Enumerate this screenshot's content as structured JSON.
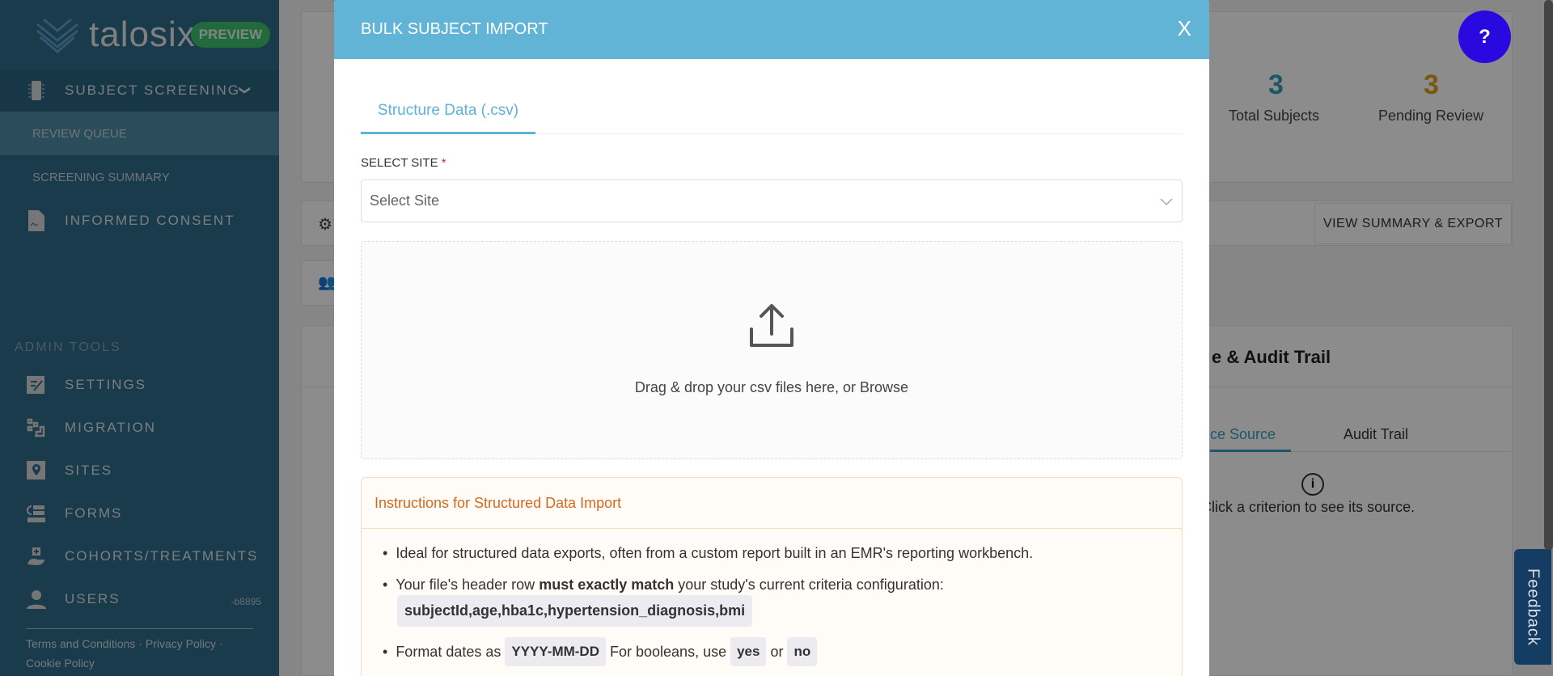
{
  "brand": {
    "name": "talosix",
    "badge": "PREVIEW"
  },
  "sidebar": {
    "section_main": {
      "label": "SUBJECT SCREENING",
      "sub_items": [
        {
          "label": "REVIEW QUEUE"
        },
        {
          "label": "SCREENING SUMMARY"
        }
      ]
    },
    "informed_consent": "INFORMED CONSENT",
    "admin_title": "ADMIN TOOLS",
    "admin_items": [
      {
        "label": "SETTINGS"
      },
      {
        "label": "MIGRATION"
      },
      {
        "label": "SITES"
      },
      {
        "label": "FORMS"
      },
      {
        "label": "COHORTS/TREATMENTS"
      },
      {
        "label": "USERS"
      }
    ],
    "version": "-b8895",
    "footer": {
      "terms": "Terms and Conditions",
      "privacy": "Privacy Policy",
      "cookie": "Cookie Policy",
      "sep": "·"
    }
  },
  "stats": [
    {
      "value": "3",
      "label": "Total Subjects",
      "color": "#3a9cc0"
    },
    {
      "value": "3",
      "label": "Pending Review",
      "color": "#d9a11a"
    }
  ],
  "summary_button": "VIEW SUMMARY & EXPORT",
  "panel": {
    "title": "e & Audit Trail",
    "tabs": [
      "ce Source",
      "Audit Trail"
    ],
    "empty": "Click a criterion to see its source."
  },
  "help": "?",
  "feedback": "Feedback",
  "modal": {
    "title": "BULK SUBJECT IMPORT",
    "close": "X",
    "tab": "Structure Data (.csv)",
    "site_label": "SELECT SITE",
    "required": "*",
    "site_placeholder": "Select Site",
    "drop_text": "Drag & drop your csv files here, or Browse",
    "instructions": {
      "title": "Instructions for Structured Data Import",
      "b1": "Ideal for structured data exports, often from a custom report built in an EMR's reporting workbench.",
      "b2_pre": "Your file's header row ",
      "b2_bold": "must exactly match",
      "b2_post": " your study's current criteria configuration:",
      "header_row": "subjectId,age,hba1c,hypertension_diagnosis,bmi",
      "b3_pre": "Format dates as",
      "date_fmt": "YYYY-MM-DD",
      "b3_mid": "For booleans, use",
      "yes": "yes",
      "or": "or",
      "no": "no"
    }
  }
}
